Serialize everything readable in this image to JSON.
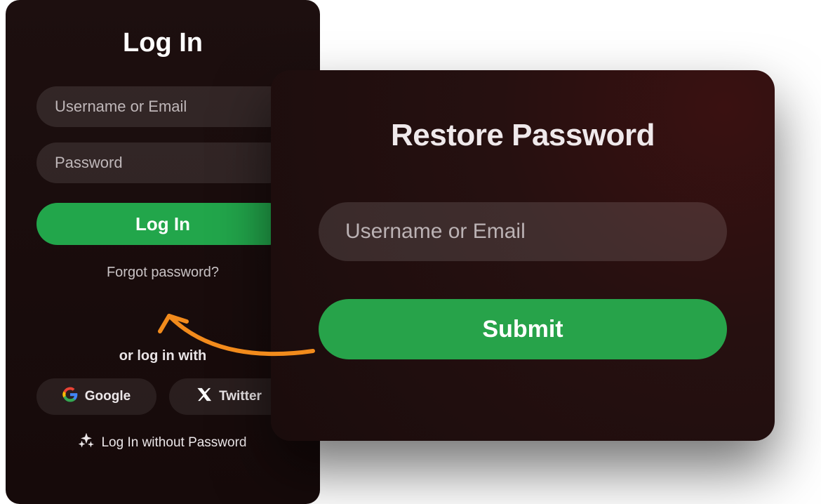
{
  "login": {
    "title": "Log In",
    "username_placeholder": "Username or Email",
    "password_placeholder": "Password",
    "login_button": "Log In",
    "forgot_link": "Forgot password?",
    "or_text": "or log in with",
    "google_label": "Google",
    "twitter_label": "Twitter",
    "passwordless_label": "Log In without Password"
  },
  "restore": {
    "title": "Restore Password",
    "username_placeholder": "Username or Email",
    "submit_button": "Submit"
  },
  "colors": {
    "primary_green": "#22a64b",
    "panel_bg": "#1a0d0d",
    "arrow": "#f28b1c"
  }
}
